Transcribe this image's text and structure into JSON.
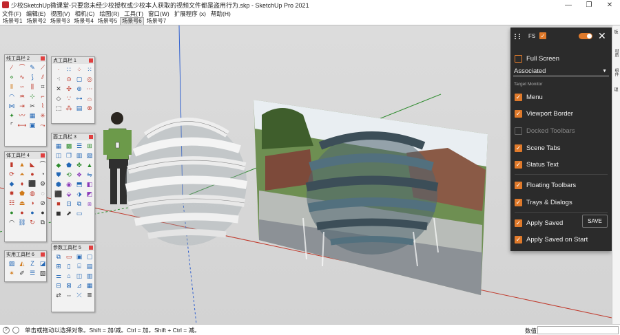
{
  "window": {
    "title": "少校SketchUp微课堂-只要您未经少校授权或少校本人获取的视频文件都是盗用行为.skp - SketchUp Pro 2021",
    "minimize": "—",
    "maximize": "❐",
    "close": "✕"
  },
  "menu": [
    "文件(F)",
    "编辑(E)",
    "视图(V)",
    "相机(C)",
    "绘图(R)",
    "工具(T)",
    "窗口(W)",
    "扩展程序 (x)",
    "帮助(H)"
  ],
  "scene_tabs": [
    "场景号1",
    "场景号2",
    "场景号3",
    "场景号4",
    "场景号5",
    "场景号6",
    "场景号7"
  ],
  "active_scene_index": 5,
  "toolbars": {
    "line": {
      "title": "线工具栏 2"
    },
    "point": {
      "title": "点工具栏 1"
    },
    "face": {
      "title": "面工具栏 3"
    },
    "solid": {
      "title": "体工具栏 4"
    },
    "param": {
      "title": "参数工具栏 5"
    },
    "util": {
      "title": "实用工具栏 6"
    }
  },
  "panel": {
    "fs_label": "FS",
    "full_screen": "Full Screen",
    "monitor_select": "Associated",
    "target_monitor": "Target Monitor",
    "menu": "Menu",
    "viewport_border": "Viewport Border",
    "docked_toolbars": "Docked Toolbars",
    "scene_tabs": "Scene Tabs",
    "status_text": "Status Text",
    "floating_toolbars": "Floating Toolbars",
    "trays_dialogs": "Trays & Dialogs",
    "apply_saved": "Apply Saved",
    "apply_saved_on_start": "Apply Saved on Start",
    "save_button": "SAVE",
    "close": "✕",
    "check": "✓"
  },
  "right_tray": [
    "默认面板",
    "材质",
    "组件",
    "场景管理"
  ],
  "status": {
    "info_icon": "?",
    "text": "单击或拖动以选择对象。Shift = 加/减。Ctrl = 加。Shift + Ctrl = 减。",
    "measure_label": "数值"
  },
  "colors": {
    "accent": "#e07a2b",
    "panel_bg": "#2b2b2b",
    "axis_red": "#c0392b",
    "axis_green": "#2e8b2e",
    "axis_blue": "#2e5fcf"
  }
}
